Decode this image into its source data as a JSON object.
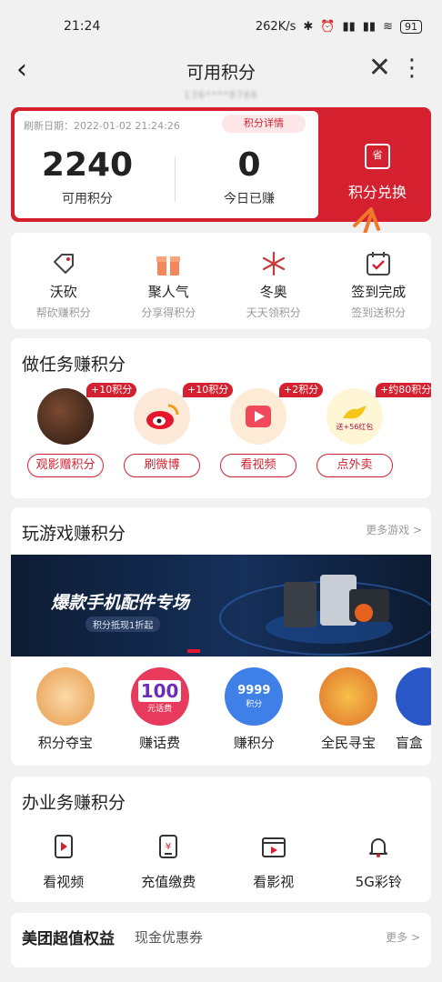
{
  "status": {
    "time": "21:24",
    "speed": "262K/s",
    "battery": "91"
  },
  "topbar": {
    "title": "可用积分",
    "subtitle": "136****8766"
  },
  "card": {
    "refresh": "刷新日期：2022-01-02 21:24:26",
    "detail": "积分详情",
    "available_value": "2240",
    "available_label": "可用积分",
    "today_value": "0",
    "today_label": "今日已赚",
    "exchange_icon": "省",
    "exchange_label": "积分兑换"
  },
  "quick": [
    {
      "title": "沃砍",
      "sub": "帮砍赚积分",
      "icon": "tag-icon"
    },
    {
      "title": "聚人气",
      "sub": "分享得积分",
      "icon": "gift-icon"
    },
    {
      "title": "冬奥",
      "sub": "天天领积分",
      "icon": "snowflake-icon"
    },
    {
      "title": "签到完成",
      "sub": "签到送积分",
      "icon": "calendar-check-icon"
    }
  ],
  "tasks": {
    "title": "做任务赚积分",
    "items": [
      {
        "badge": "+10积分",
        "label": "观影赠积分"
      },
      {
        "badge": "+10积分",
        "label": "刷微博"
      },
      {
        "badge": "+2积分",
        "label": "看视频"
      },
      {
        "badge": "+约80积分",
        "label": "点外卖",
        "extra": "送+56红包"
      }
    ]
  },
  "games": {
    "title": "玩游戏赚积分",
    "more": "更多游戏 >",
    "banner_title": "爆款手机配件专场",
    "banner_sub": "积分抵现1折起",
    "items": [
      {
        "label": "积分夺宝"
      },
      {
        "label": "赚话费",
        "icon_text": "100",
        "icon_sub": "元话费"
      },
      {
        "label": "赚积分",
        "icon_text": "9999",
        "icon_sub": "积分"
      },
      {
        "label": "全民寻宝"
      },
      {
        "label": "盲盒"
      }
    ]
  },
  "biz": {
    "title": "办业务赚积分",
    "items": [
      {
        "label": "看视频",
        "icon": "video-phone-icon"
      },
      {
        "label": "充值缴费",
        "icon": "recharge-icon"
      },
      {
        "label": "看影视",
        "icon": "film-icon"
      },
      {
        "label": "5G彩铃",
        "icon": "bell-icon"
      }
    ]
  },
  "meituan": {
    "title": "美团超值权益",
    "sub": "现金优惠券",
    "more": "更多 >"
  },
  "colors": {
    "accent": "#d4202f",
    "orange": "#f07a2a"
  }
}
